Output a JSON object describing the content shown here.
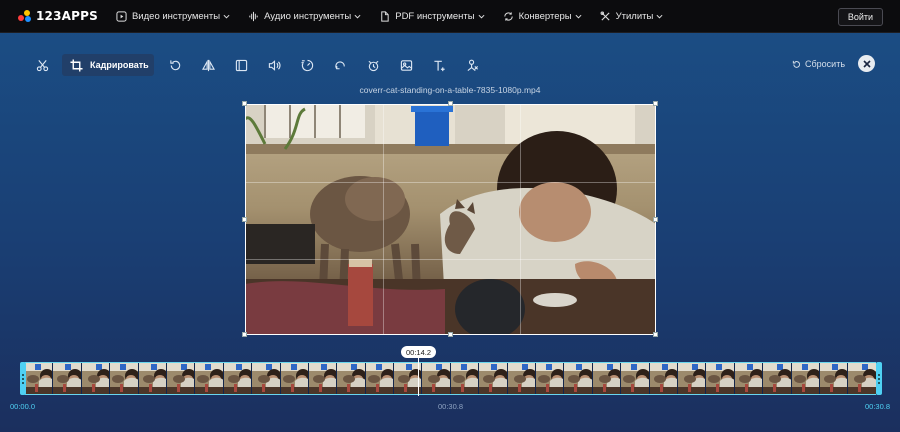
{
  "nav": {
    "logo": "123APPS",
    "items": [
      {
        "label": "Видео инструменты",
        "icon": "video-play-icon"
      },
      {
        "label": "Аудио инструменты",
        "icon": "audio-wave-icon"
      },
      {
        "label": "PDF инструменты",
        "icon": "document-icon"
      },
      {
        "label": "Конвертеры",
        "icon": "convert-refresh-icon"
      },
      {
        "label": "Утилиты",
        "icon": "wrench-tools-icon"
      }
    ],
    "login": "Войти"
  },
  "toolbar": {
    "tools": [
      "scissors-icon",
      "crop-icon",
      "rotate-icon",
      "flip-icon",
      "resize-frame-icon",
      "volume-icon",
      "speed-icon",
      "loop-icon",
      "stabilize-icon",
      "image-icon",
      "text-icon",
      "remove-logo-icon"
    ],
    "active_label": "Кадрировать",
    "reset_label": "Сбросить"
  },
  "video": {
    "filename": "coverr-cat-standing-on-a-table-7835-1080p.mp4"
  },
  "timeline": {
    "current": "00:14.2",
    "start": "00:00.0",
    "middle": "00:30.8",
    "end": "00:30.8",
    "playhead_fraction": 0.465
  },
  "colors": {
    "accent": "#4fd1f3",
    "toolbar_active": "#213f69",
    "nav_bg": "#0c0c0e"
  }
}
